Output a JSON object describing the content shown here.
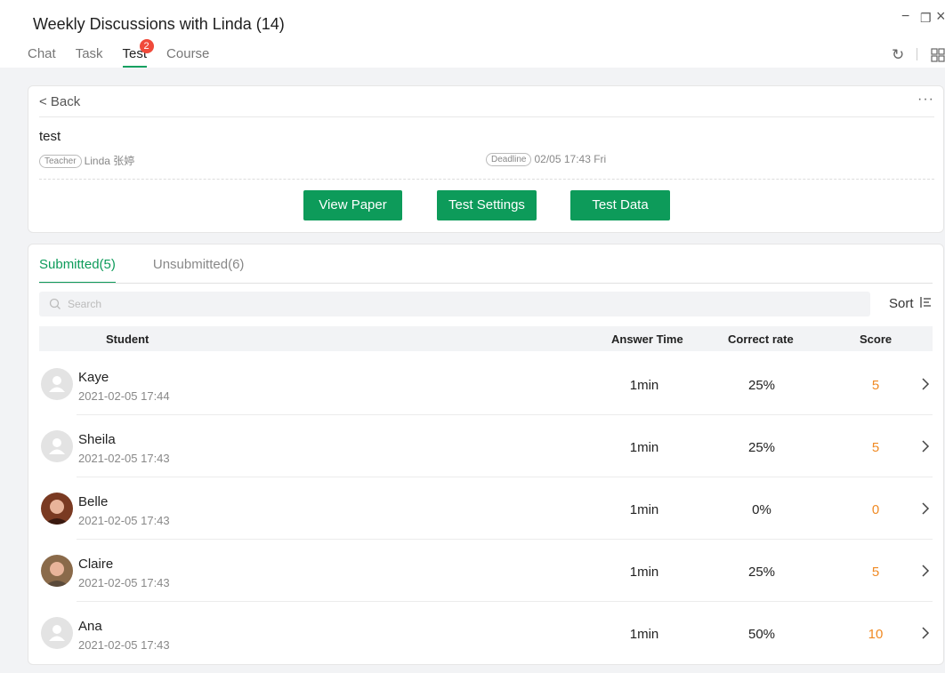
{
  "window": {
    "title": "Weekly Discussions with Linda (14)",
    "controls": {
      "minimize": "−",
      "restore": "❐",
      "close": "×"
    }
  },
  "tabs": [
    {
      "label": "Chat"
    },
    {
      "label": "Task"
    },
    {
      "label": "Test",
      "badge": "2"
    },
    {
      "label": "Course"
    }
  ],
  "toolbar": {
    "refresh": "↻"
  },
  "test": {
    "back_label": "< Back",
    "more_label": "···",
    "name": "test",
    "teacher_tag": "Teacher",
    "teacher_name": "Linda 张婷",
    "deadline_tag": "Deadline",
    "deadline_value": "02/05 17:43 Fri",
    "buttons": {
      "view_paper": "View Paper",
      "test_settings": "Test Settings",
      "test_data": "Test Data"
    }
  },
  "submissions": {
    "tabs": [
      {
        "label": "Submitted(5)"
      },
      {
        "label": "Unsubmitted(6)"
      }
    ],
    "search_placeholder": "Search",
    "sort_label": "Sort",
    "columns": {
      "student": "Student",
      "answer_time": "Answer Time",
      "correct_rate": "Correct rate",
      "score": "Score"
    },
    "rows": [
      {
        "name": "Kaye",
        "time": "2021-02-05 17:44",
        "answer_time": "1min",
        "correct_rate": "25%",
        "score": "5",
        "avatar": "default-avatar"
      },
      {
        "name": "Sheila",
        "time": "2021-02-05 17:43",
        "answer_time": "1min",
        "correct_rate": "25%",
        "score": "5",
        "avatar": "default-avatar"
      },
      {
        "name": "Belle",
        "time": "2021-02-05 17:43",
        "answer_time": "1min",
        "correct_rate": "0%",
        "score": "0",
        "avatar": "photo-avatar"
      },
      {
        "name": "Claire",
        "time": "2021-02-05 17:43",
        "answer_time": "1min",
        "correct_rate": "25%",
        "score": "5",
        "avatar": "photo-avatar"
      },
      {
        "name": "Ana",
        "time": "2021-02-05 17:43",
        "answer_time": "1min",
        "correct_rate": "50%",
        "score": "10",
        "avatar": "default-avatar"
      }
    ]
  },
  "colors": {
    "accent": "#0d9b5a",
    "score": "#f08a24",
    "badge": "#f04a3a"
  }
}
